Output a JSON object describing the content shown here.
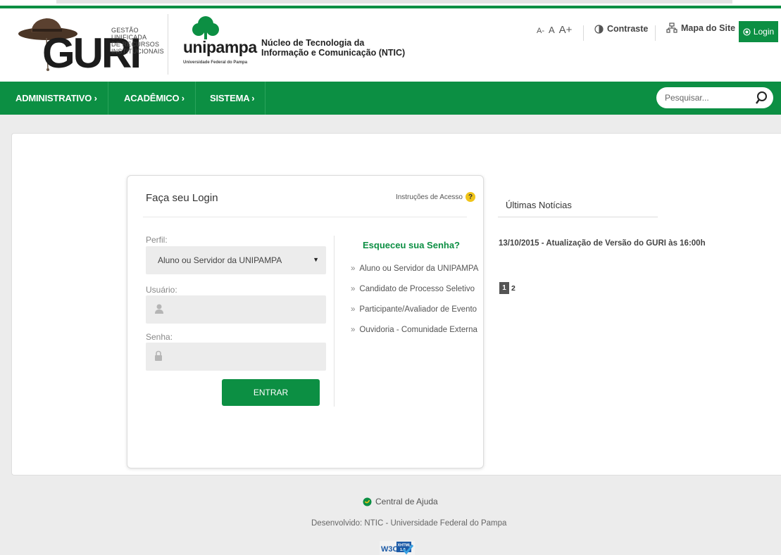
{
  "brand": {
    "guri_word": "GURI",
    "guri_subtitle": [
      "GESTÃO",
      "UNIFICADA",
      "DE RECURSOS",
      "INSTITUCIONAIS"
    ],
    "unipampa_word": "unipampa",
    "unipampa_sub": "Universidade Federal do Pampa",
    "ntic_line1": "Núcleo de Tecnologia da",
    "ntic_line2": "Informação e Comunicação (NTIC)"
  },
  "toolbar": {
    "font_small": "A-",
    "font_normal": "A",
    "font_large": "A+",
    "contrast": "Contraste",
    "sitemap": "Mapa do Site",
    "login": "Login"
  },
  "nav": {
    "items": [
      "ADMINISTRATIVO ›",
      "ACADÊMICO ›",
      "SISTEMA ›"
    ],
    "search_placeholder": "Pesquisar..."
  },
  "login": {
    "title": "Faça seu Login",
    "instructions": "Instruções de Acesso",
    "help_mark": "?",
    "perfil_label": "Perfil:",
    "perfil_value": "Aluno ou Servidor da UNIPAMPA",
    "usuario_label": "Usuário:",
    "usuario_value": "",
    "senha_label": "Senha:",
    "senha_value": "",
    "submit": "ENTRAR"
  },
  "forgot": {
    "title": "Esqueceu sua Senha?",
    "bullet": "»",
    "items": [
      "Aluno ou Servidor da UNIPAMPA",
      "Candidato de Processo Seletivo",
      "Participante/Avaliador de Evento",
      "Ouvidoria - Comunidade Externa"
    ]
  },
  "news": {
    "title": "Últimas Notícias",
    "items": [
      "13/10/2015 - Atualização de Versão do GURI às 16:00h"
    ],
    "pages": [
      "1",
      "2"
    ],
    "active_page": "1"
  },
  "footer": {
    "help": "Central de Ajuda",
    "developed": "Desenvolvido: NTIC - Universidade Federal do Pampa",
    "badge_w3c": "W3C",
    "badge_xhtml": "XHTML",
    "badge_version": "1.0"
  },
  "colors": {
    "brand_green": "#0c8f43",
    "page_bg": "#ececec",
    "help_yellow": "#f0c419"
  }
}
